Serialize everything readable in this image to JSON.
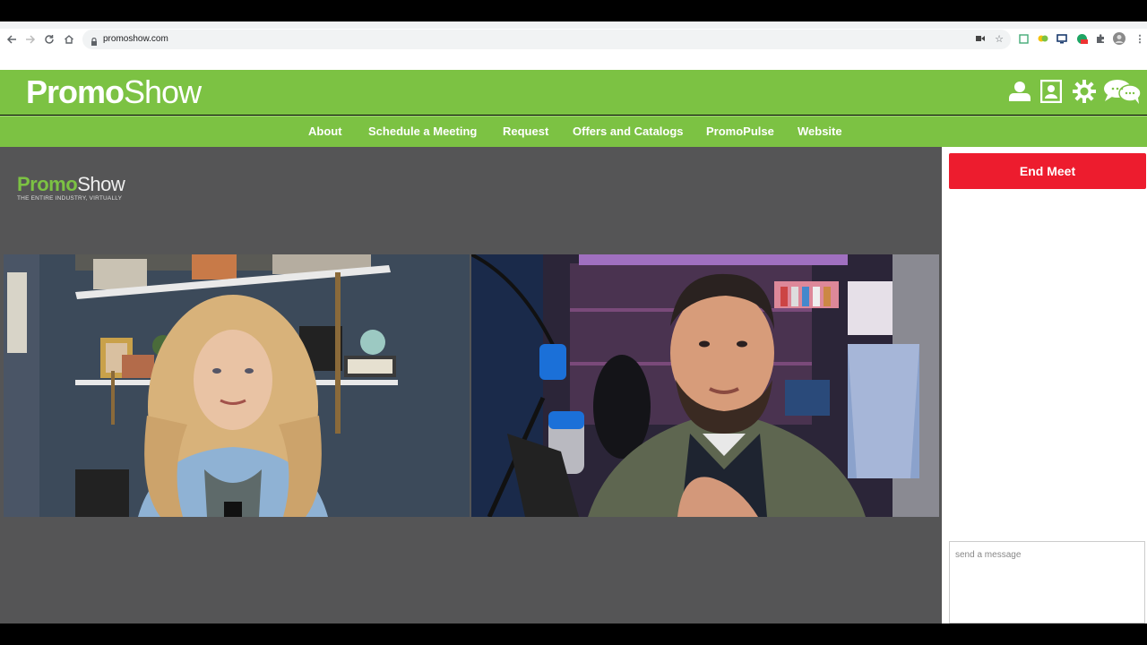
{
  "browser": {
    "url": "promoshow.com"
  },
  "header": {
    "logo_bold": "Promo",
    "logo_light": "Show",
    "icons": [
      "user-icon",
      "profile-card-icon",
      "gear-icon",
      "chat-bubbles-icon"
    ]
  },
  "nav": {
    "items": [
      {
        "label": "About"
      },
      {
        "label": "Schedule a Meeting"
      },
      {
        "label": "Request"
      },
      {
        "label": "Offers and Catalogs"
      },
      {
        "label": "PromoPulse"
      },
      {
        "label": "Website"
      }
    ]
  },
  "stage": {
    "logo_bold": "Promo",
    "logo_light": "Show",
    "tagline": "THE ENTIRE INDUSTRY, VIRTUALLY"
  },
  "panel": {
    "end_meet_label": "End Meet",
    "message_placeholder": "send a message"
  },
  "colors": {
    "brand_green": "#7cc243",
    "end_red": "#ed1c2e",
    "stage_gray": "#555556"
  }
}
